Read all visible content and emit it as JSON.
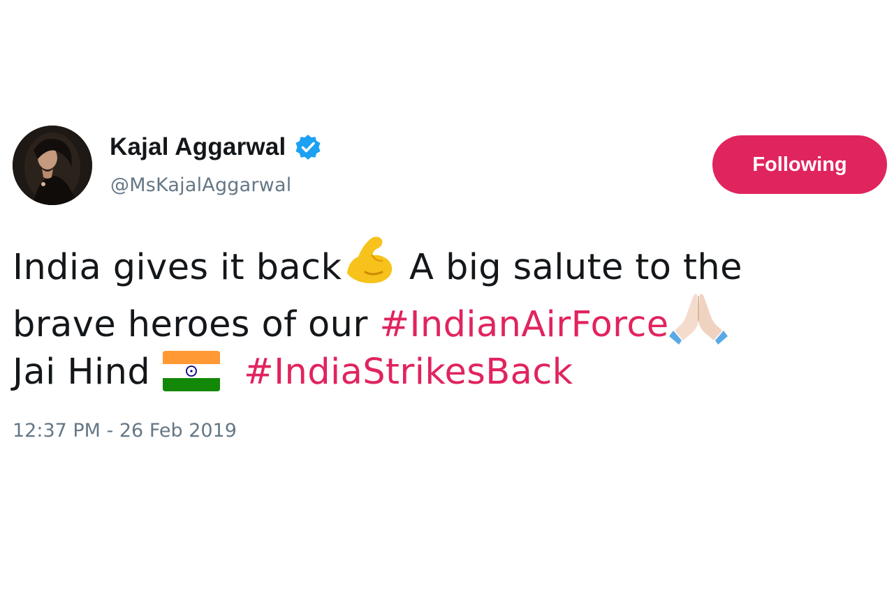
{
  "author": {
    "display_name": "Kajal Aggarwal",
    "handle": "@MsKajalAggarwal",
    "verified": true,
    "avatar_icon": "profile-photo"
  },
  "follow_button": {
    "label": "Following",
    "color": "#e0245e"
  },
  "tweet": {
    "line1": {
      "text_a": "India gives it back",
      "emoji_a": "flexed-biceps-icon",
      "text_b": " A big salute to the"
    },
    "line2": {
      "text_a": "brave heroes of our ",
      "hashtag": "#IndianAirForce",
      "emoji": "folded-hands-icon"
    },
    "line3": {
      "text_a": "Jai Hind ",
      "emoji": "india-flag-icon",
      "hashtag": "#IndiaStrikesBack"
    }
  },
  "timestamp": "12:37 PM - 26 Feb 2019",
  "colors": {
    "text": "#14171a",
    "muted": "#657786",
    "hashtag": "#e0245e",
    "verified": "#1da1f2"
  }
}
